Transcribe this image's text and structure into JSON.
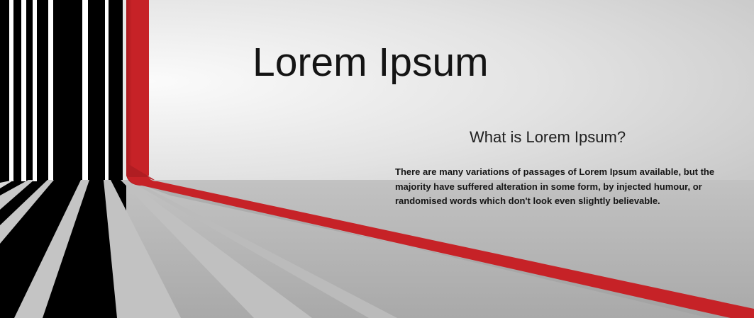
{
  "content": {
    "title": "Lorem Ipsum",
    "subtitle": "What is Lorem Ipsum?",
    "paragraph": "There are many variations of passages of Lorem Ipsum available, but the majority have suffered alteration in some form, by injected humour, or randomised words which don't look even slightly believable."
  },
  "colors": {
    "accent_red": "#c62227",
    "stripe_black": "#000000",
    "background_light": "#f2f2f2",
    "background_grey": "#b4b4b4"
  }
}
